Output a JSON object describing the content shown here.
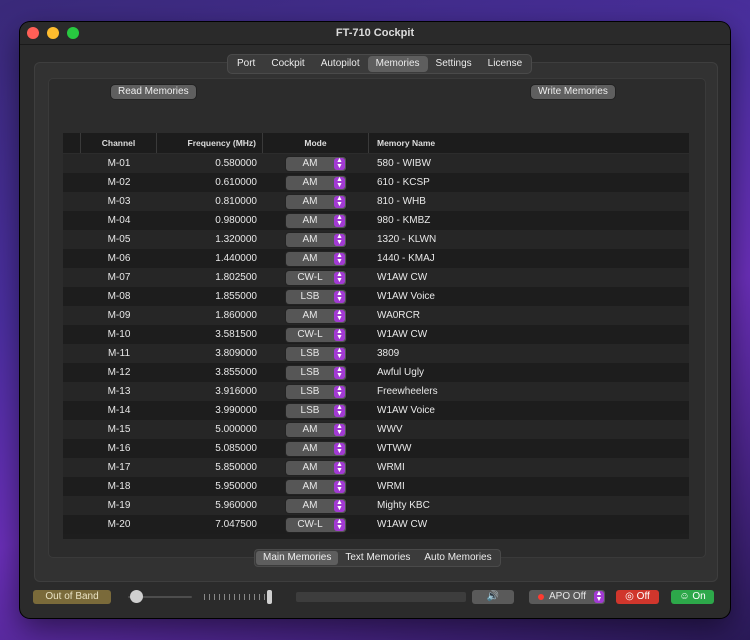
{
  "window": {
    "title": "FT-710 Cockpit"
  },
  "tabs": [
    "Port",
    "Cockpit",
    "Autopilot",
    "Memories",
    "Settings",
    "License"
  ],
  "active_tab": "Memories",
  "actions": {
    "read": "Read Memories",
    "write": "Write Memories"
  },
  "table": {
    "headers": {
      "channel": "Channel",
      "frequency": "Frequency (MHz)",
      "mode": "Mode",
      "name": "Memory Name"
    },
    "rows": [
      {
        "channel": "M-01",
        "frequency": "0.580000",
        "mode": "AM",
        "name": "580 - WIBW"
      },
      {
        "channel": "M-02",
        "frequency": "0.610000",
        "mode": "AM",
        "name": "610 - KCSP"
      },
      {
        "channel": "M-03",
        "frequency": "0.810000",
        "mode": "AM",
        "name": "810 - WHB"
      },
      {
        "channel": "M-04",
        "frequency": "0.980000",
        "mode": "AM",
        "name": "980 - KMBZ"
      },
      {
        "channel": "M-05",
        "frequency": "1.320000",
        "mode": "AM",
        "name": "1320 - KLWN"
      },
      {
        "channel": "M-06",
        "frequency": "1.440000",
        "mode": "AM",
        "name": "1440 - KMAJ"
      },
      {
        "channel": "M-07",
        "frequency": "1.802500",
        "mode": "CW-L",
        "name": "W1AW CW"
      },
      {
        "channel": "M-08",
        "frequency": "1.855000",
        "mode": "LSB",
        "name": "W1AW Voice"
      },
      {
        "channel": "M-09",
        "frequency": "1.860000",
        "mode": "AM",
        "name": "WA0RCR"
      },
      {
        "channel": "M-10",
        "frequency": "3.581500",
        "mode": "CW-L",
        "name": "W1AW CW"
      },
      {
        "channel": "M-11",
        "frequency": "3.809000",
        "mode": "LSB",
        "name": "3809"
      },
      {
        "channel": "M-12",
        "frequency": "3.855000",
        "mode": "LSB",
        "name": "Awful Ugly"
      },
      {
        "channel": "M-13",
        "frequency": "3.916000",
        "mode": "LSB",
        "name": "Freewheelers"
      },
      {
        "channel": "M-14",
        "frequency": "3.990000",
        "mode": "LSB",
        "name": "W1AW Voice"
      },
      {
        "channel": "M-15",
        "frequency": "5.000000",
        "mode": "AM",
        "name": "WWV"
      },
      {
        "channel": "M-16",
        "frequency": "5.085000",
        "mode": "AM",
        "name": "WTWW"
      },
      {
        "channel": "M-17",
        "frequency": "5.850000",
        "mode": "AM",
        "name": "WRMI"
      },
      {
        "channel": "M-18",
        "frequency": "5.950000",
        "mode": "AM",
        "name": "WRMI"
      },
      {
        "channel": "M-19",
        "frequency": "5.960000",
        "mode": "AM",
        "name": "Mighty KBC"
      },
      {
        "channel": "M-20",
        "frequency": "7.047500",
        "mode": "CW-L",
        "name": "W1AW CW"
      }
    ]
  },
  "subtabs": [
    "Main Memories",
    "Text Memories",
    "Auto Memories"
  ],
  "active_subtab": "Main Memories",
  "status": {
    "out_of_band": "Out of Band",
    "apo": "APO Off",
    "off": "Off",
    "on": "On",
    "speaker_icon": "speaker-icon",
    "volume_level": 0.0,
    "colors": {
      "off": "#d0362c",
      "on": "#2da84a",
      "accent": "#a23ad3",
      "oob": "#7a6a3a"
    }
  }
}
